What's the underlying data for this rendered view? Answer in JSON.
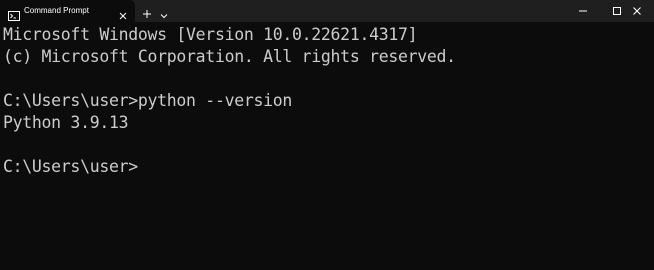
{
  "window": {
    "tab_title": "Command Prompt",
    "tab_icon": "terminal-icon",
    "close_tab_icon": "close-icon",
    "new_tab_icon": "plus-icon",
    "dropdown_icon": "chevron-down-icon",
    "minimize_icon": "minimize-icon",
    "maximize_icon": "maximize-icon",
    "close_window_icon": "close-icon"
  },
  "terminal": {
    "lines": [
      "Microsoft Windows [Version 10.0.22621.4317]",
      "(c) Microsoft Corporation. All rights reserved.",
      "",
      "C:\\Users\\user>python --version",
      "Python 3.9.13",
      "",
      "C:\\Users\\user>"
    ]
  },
  "colors": {
    "background": "#0c0c0c",
    "titlebar": "#1f1f1f",
    "text": "#cccccc"
  }
}
